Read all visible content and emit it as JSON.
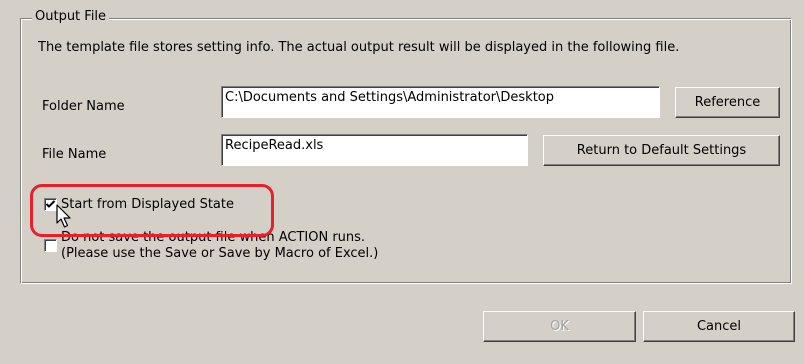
{
  "output_file": {
    "group_title": "Output File",
    "description": "The template file stores setting info. The actual output result will be displayed in the following file.",
    "folder": {
      "label": "Folder Name",
      "value": "C:\\Documents and Settings\\Administrator\\Desktop",
      "button_label": "Reference"
    },
    "file": {
      "label": "File Name",
      "value": "RecipeRead.xls",
      "button_label": "Return to Default Settings"
    },
    "start_from_displayed": {
      "label": "Start from Displayed State",
      "checked": true
    },
    "do_not_save": {
      "label_line1": "Do not save the output file when ACTION runs.",
      "label_line2": "(Please use the Save or Save by Macro of Excel.)",
      "checked": false
    }
  },
  "footer": {
    "ok_label": "OK",
    "ok_enabled": false,
    "cancel_label": "Cancel"
  },
  "annotation": {
    "highlight_color": "#e8202a"
  }
}
